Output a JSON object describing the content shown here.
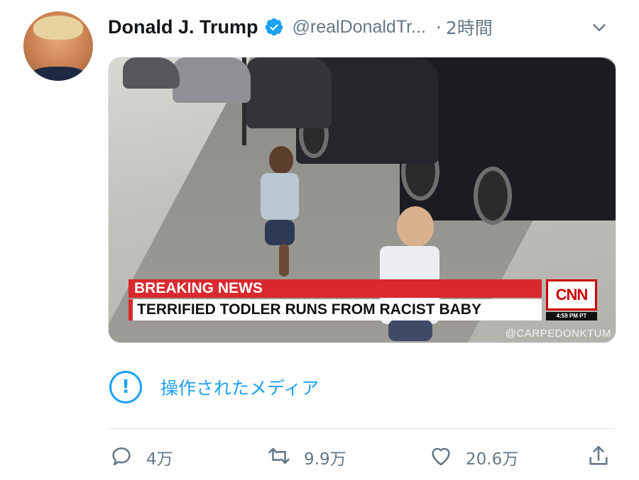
{
  "tweet": {
    "author_name": "Donald J. Trump",
    "handle": "@realDonaldTr...",
    "separator": "·",
    "time": "2時間"
  },
  "media": {
    "breaking_label": "BREAKING NEWS",
    "headline": "TERRIFIED TODLER RUNS FROM RACIST BABY",
    "network_logo": "CNN",
    "broadcast_time": "4:59 PM PT",
    "watermark": "@CARPEDONKTUM"
  },
  "notice": {
    "icon_glyph": "!",
    "text": "操作されたメディア"
  },
  "actions": {
    "reply_count": "4万",
    "retweet_count": "9.9万",
    "like_count": "20.6万"
  },
  "colors": {
    "accent": "#1da1f2",
    "muted": "#657786",
    "breaking_red": "#d8292e"
  },
  "icons": [
    "verified-badge-icon",
    "chevron-down-icon",
    "alert-circle-icon",
    "reply-icon",
    "retweet-icon",
    "heart-icon",
    "share-icon"
  ]
}
